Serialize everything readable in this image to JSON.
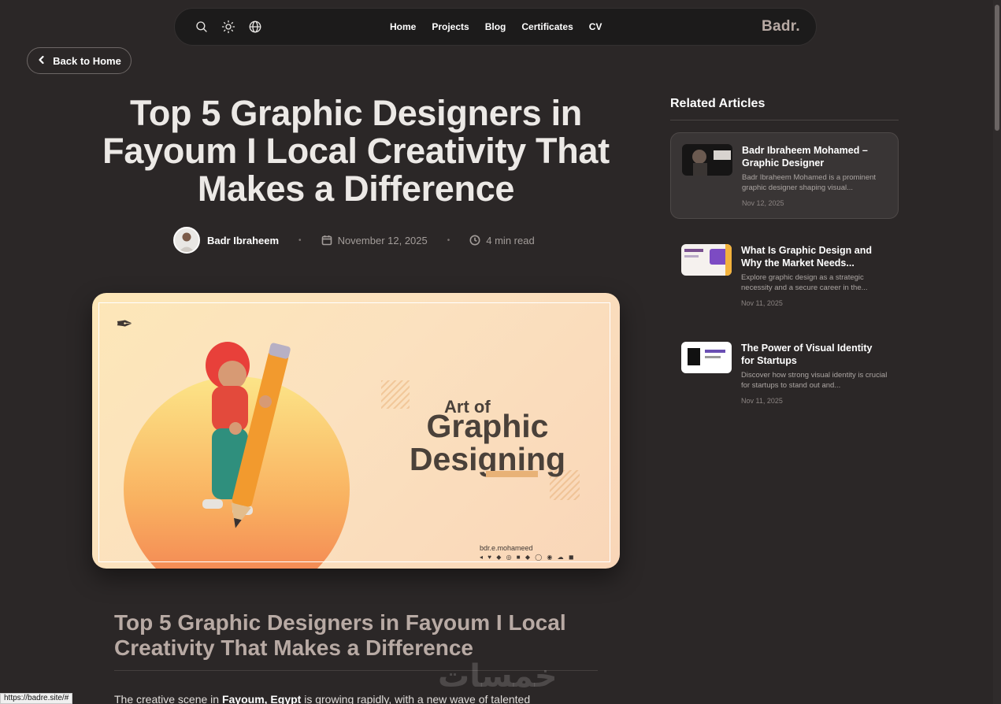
{
  "nav": {
    "links": [
      "Home",
      "Projects",
      "Blog",
      "Certificates",
      "CV"
    ],
    "brand": "Badr."
  },
  "back": {
    "label": "Back to Home"
  },
  "article": {
    "title": "Top 5 Graphic Designers in Fayoum I Local Creativity That Makes a Difference",
    "author": "Badr Ibraheem",
    "date": "November 12, 2025",
    "read_time": "4 min read",
    "hero": {
      "text_small": "Art of",
      "text_large": "Graphic Designing",
      "handle": "bdr.e.mohameed"
    },
    "heading": "Top 5 Graphic Designers in Fayoum I Local Creativity That Makes a Difference",
    "paragraph_start": "The creative scene in ",
    "paragraph_bold": "Fayoum, Egypt",
    "paragraph_end": " is growing rapidly, with a new wave of talented"
  },
  "sidebar": {
    "title": "Related Articles",
    "cards": [
      {
        "title": "Badr Ibraheem Mohamed – Graphic Designer",
        "excerpt": "Badr Ibraheem Mohamed is a prominent graphic designer shaping visual...",
        "date": "Nov 12, 2025"
      },
      {
        "title": "What Is Graphic Design and Why the Market Needs...",
        "excerpt": "Explore graphic design as a strategic necessity and a secure career in the...",
        "date": "Nov 11, 2025"
      },
      {
        "title": "The Power of Visual Identity for Startups",
        "excerpt": "Discover how strong visual identity is crucial for startups to stand out and...",
        "date": "Nov 11, 2025"
      }
    ]
  },
  "status_url": "https://badre.site/#",
  "watermark": "خمسات",
  "colors": {
    "background": "#2b2727",
    "accent": "#b8aaa4",
    "hero_orange": "#f9b160"
  }
}
